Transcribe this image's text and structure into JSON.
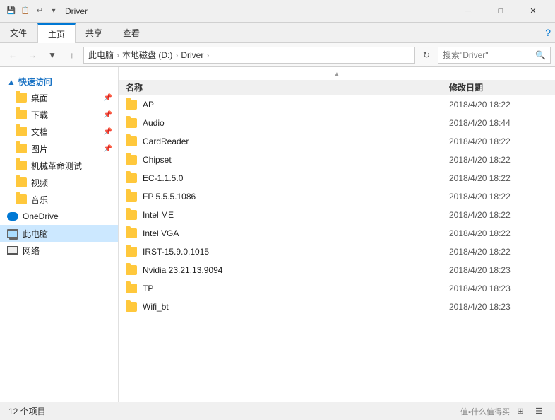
{
  "titleBar": {
    "quickAccessIcons": [
      "💾",
      "📋",
      "↩"
    ],
    "title": "Driver",
    "controls": {
      "minimize": "─",
      "maximize": "□",
      "close": "✕"
    }
  },
  "ribbon": {
    "tabs": [
      "文件",
      "主页",
      "共享",
      "查看"
    ],
    "activeTab": "主页",
    "helpIcon": "?"
  },
  "addressBar": {
    "back": "←",
    "forward": "→",
    "up": "↑",
    "breadcrumb": [
      "此电脑",
      "本地磁盘 (D:)",
      "Driver"
    ],
    "refresh": "⟳",
    "searchPlaceholder": "搜索\"Driver\"",
    "searchIcon": "🔍"
  },
  "sidebar": {
    "quickAccess": {
      "title": "快速访问",
      "items": [
        {
          "label": "桌面",
          "pinned": true
        },
        {
          "label": "下载",
          "pinned": true
        },
        {
          "label": "文档",
          "pinned": true
        },
        {
          "label": "图片",
          "pinned": true
        },
        {
          "label": "机械革命测试"
        },
        {
          "label": "视频"
        },
        {
          "label": "音乐"
        }
      ]
    },
    "oneDrive": {
      "label": "OneDrive"
    },
    "thisPC": {
      "label": "此电脑",
      "selected": true
    },
    "network": {
      "label": "网络"
    }
  },
  "fileList": {
    "columns": {
      "name": "名称",
      "date": "修改日期"
    },
    "sortAsc": "▲",
    "items": [
      {
        "name": "AP",
        "date": "2018/4/20 18:22"
      },
      {
        "name": "Audio",
        "date": "2018/4/20 18:44"
      },
      {
        "name": "CardReader",
        "date": "2018/4/20 18:22"
      },
      {
        "name": "Chipset",
        "date": "2018/4/20 18:22"
      },
      {
        "name": "EC-1.1.5.0",
        "date": "2018/4/20 18:22"
      },
      {
        "name": "FP 5.5.5.1086",
        "date": "2018/4/20 18:22"
      },
      {
        "name": "Intel ME",
        "date": "2018/4/20 18:22"
      },
      {
        "name": "Intel VGA",
        "date": "2018/4/20 18:22"
      },
      {
        "name": "IRST-15.9.0.1015",
        "date": "2018/4/20 18:22"
      },
      {
        "name": "Nvidia 23.21.13.9094",
        "date": "2018/4/20 18:23"
      },
      {
        "name": "TP",
        "date": "2018/4/20 18:23"
      },
      {
        "name": "Wifi_bt",
        "date": "2018/4/20 18:23"
      }
    ]
  },
  "statusBar": {
    "itemCount": "12 个项目",
    "viewIcons": [
      "⊞",
      "☰"
    ]
  },
  "watermark": "值▪什么值得买"
}
